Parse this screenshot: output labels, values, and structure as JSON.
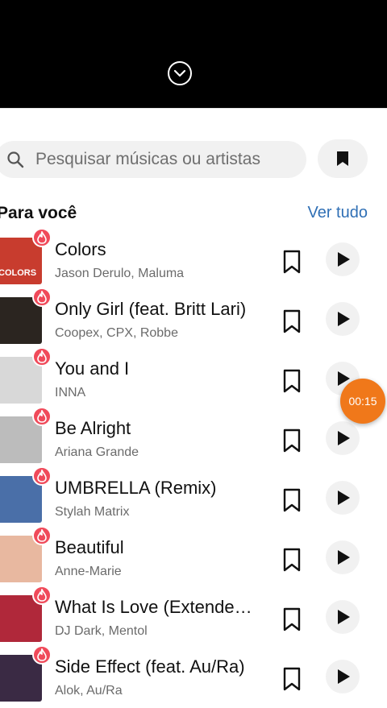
{
  "search": {
    "placeholder": "Pesquisar músicas ou artistas"
  },
  "section": {
    "title": "Para você",
    "see_all": "Ver tudo"
  },
  "timer": "00:15",
  "songs": [
    {
      "title": "Colors",
      "artist": "Jason Derulo, Maluma",
      "cover_color": "#c83c2e",
      "cover_text": "COLORS"
    },
    {
      "title": "Only Girl (feat. Britt Lari)",
      "artist": "Coopex, CPX, Robbe",
      "cover_color": "#2b2520",
      "cover_text": ""
    },
    {
      "title": "You and I",
      "artist": "INNA",
      "cover_color": "#d8d8d8",
      "cover_text": ""
    },
    {
      "title": "Be Alright",
      "artist": "Ariana Grande",
      "cover_color": "#bcbcbc",
      "cover_text": ""
    },
    {
      "title": "UMBRELLA (Remix)",
      "artist": "Stylah Matrix",
      "cover_color": "#4a6fa8",
      "cover_text": ""
    },
    {
      "title": "Beautiful",
      "artist": "Anne-Marie",
      "cover_color": "#e8b8a0",
      "cover_text": ""
    },
    {
      "title": "What Is Love (Extended Mix)",
      "artist": "DJ Dark, Mentol",
      "cover_color": "#b0283a",
      "cover_text": ""
    },
    {
      "title": "Side Effect (feat. Au/Ra)",
      "artist": "Alok, Au/Ra",
      "cover_color": "#3a2a44",
      "cover_text": ""
    }
  ]
}
